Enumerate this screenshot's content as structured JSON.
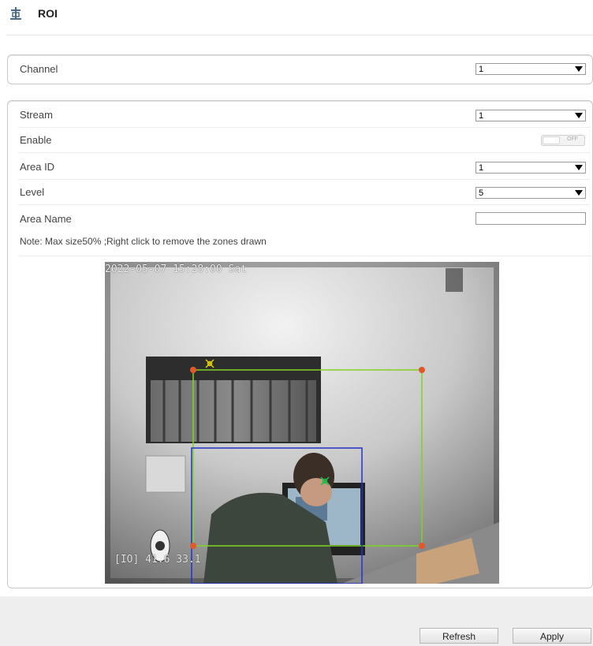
{
  "header": {
    "title": "ROI",
    "icon": "roi-icon"
  },
  "channel": {
    "label": "Channel",
    "value": "1"
  },
  "settings": {
    "stream": {
      "label": "Stream",
      "value": "1"
    },
    "enable": {
      "label": "Enable",
      "state": "OFF"
    },
    "area_id": {
      "label": "Area ID",
      "value": "1"
    },
    "level": {
      "label": "Level",
      "value": "5"
    },
    "area_name": {
      "label": "Area Name",
      "value": ""
    },
    "note": "Note: Max size50% ;Right click to remove the zones drawn"
  },
  "video": {
    "timestamp": "2022-05-07 15:28:00 Sat",
    "osd_bottom": "[IO] 41.6 33.1",
    "zone_colors": {
      "green": "#7ed321",
      "blue": "#2133c9",
      "handle": "#e2572b"
    }
  },
  "footer": {
    "refresh_label": "Refresh",
    "apply_label": "Apply"
  }
}
